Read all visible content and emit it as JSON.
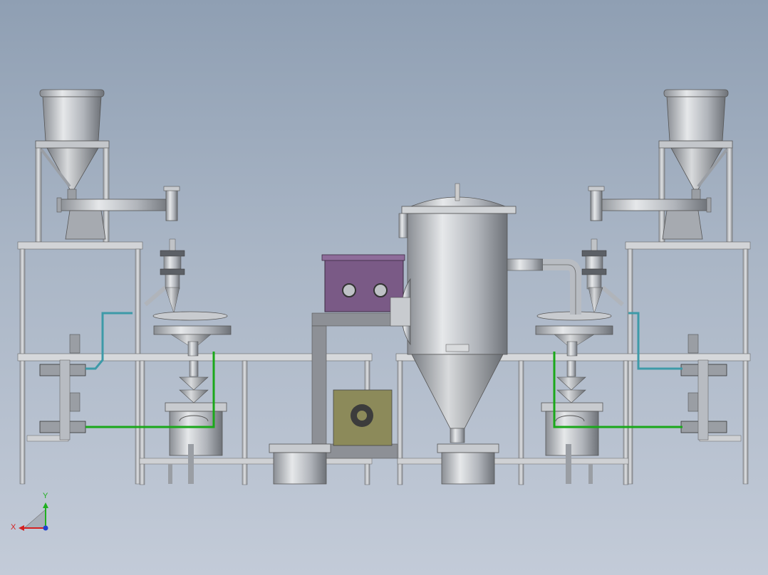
{
  "colors": {
    "background_top": "#8f9fb3",
    "background_bottom": "#c3cbd8",
    "steel": "#b8bcc2",
    "steel_dark": "#7d8187",
    "frame": "#c9ccd0",
    "pipe_green": "#1aa81a",
    "pipe_teal": "#3d9aa8",
    "motor_box": "#7a5a86",
    "motor_base": "#8c8a5a",
    "axis_x": "#d42020",
    "axis_y": "#20b020",
    "axis_z": "#2040d0"
  },
  "triad": {
    "x_label": "X",
    "y_label": "Y"
  }
}
